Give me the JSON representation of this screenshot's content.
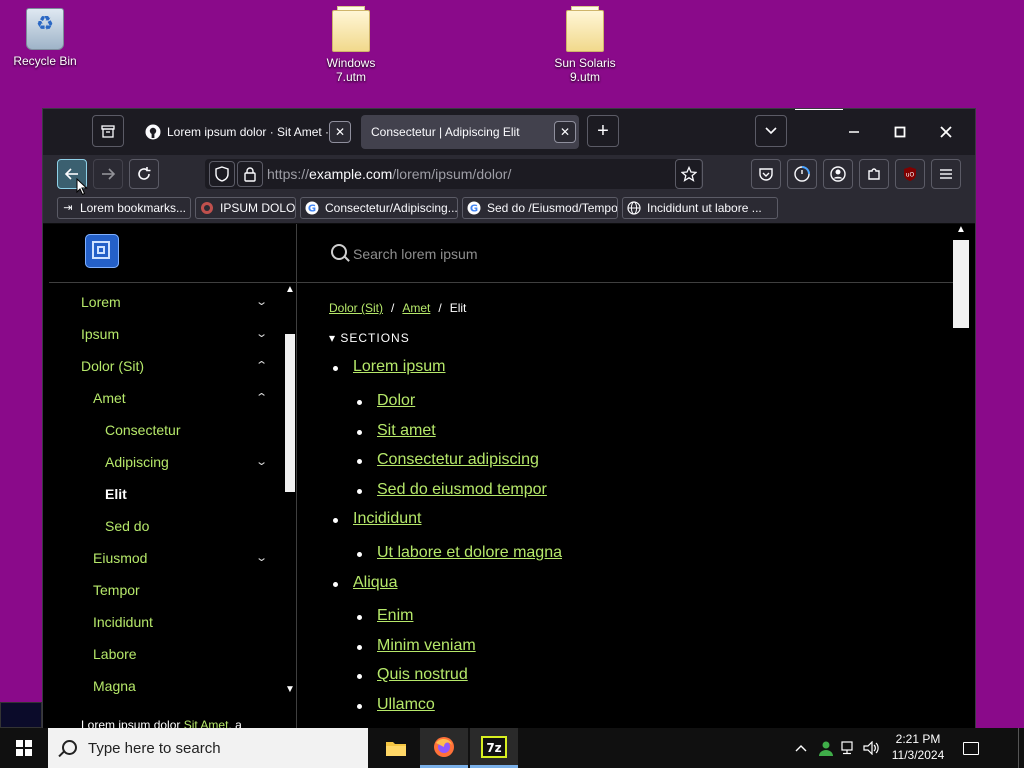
{
  "desktop": {
    "icons": [
      {
        "label": "Recycle Bin"
      },
      {
        "label": "Windows\n7.utm"
      },
      {
        "label": "Sun Solaris\n9.utm"
      }
    ]
  },
  "browser": {
    "tabs": [
      {
        "title": "Lorem ipsum dolor · Sit Amet · …",
        "active": false
      },
      {
        "title": "Consectetur | Adipiscing Elit",
        "active": true
      }
    ],
    "url": {
      "prefix": "https://",
      "host": "example.com",
      "path": "/lorem/ipsum/dolor/"
    },
    "bookmarks": [
      "Lorem bookmarks...",
      "IPSUM DOLOR",
      "Consectetur/Adipiscing...",
      "Sed do /Eiusmod/Tempor",
      "Incididunt ut labore ..."
    ]
  },
  "sidebar": {
    "items": [
      {
        "label": "Lorem",
        "level": 0,
        "chevron": "down"
      },
      {
        "label": "Ipsum",
        "level": 0,
        "chevron": "down"
      },
      {
        "label": "Dolor (Sit)",
        "level": 0,
        "chevron": "up"
      },
      {
        "label": "Amet",
        "level": 1,
        "chevron": "up"
      },
      {
        "label": "Consectetur",
        "level": 2,
        "chevron": ""
      },
      {
        "label": "Adipiscing",
        "level": 2,
        "chevron": "down"
      },
      {
        "label": "Elit",
        "level": 2,
        "chevron": "",
        "current": true
      },
      {
        "label": "Sed do",
        "level": 2,
        "chevron": ""
      },
      {
        "label": "Eiusmod",
        "level": 1,
        "chevron": "down"
      },
      {
        "label": "Tempor",
        "level": 1,
        "chevron": ""
      },
      {
        "label": "Incididunt",
        "level": 1,
        "chevron": ""
      },
      {
        "label": "Labore",
        "level": 1,
        "chevron": ""
      },
      {
        "label": "Magna",
        "level": 1,
        "chevron": ""
      }
    ],
    "footer_prefix": "Lorem ipsum dolor ",
    "footer_link": "Sit Amet",
    "footer_suffix": ", a"
  },
  "main": {
    "search_placeholder": "Search lorem ipsum",
    "breadcrumb": {
      "crumb1": "Dolor (Sit)",
      "crumb2": "Amet",
      "current": "Elit",
      "separator": "/"
    },
    "sections_label": "▾  SECTIONS",
    "toc": [
      {
        "label": "Lorem ipsum",
        "level": 0
      },
      {
        "label": "Dolor",
        "level": 1
      },
      {
        "label": "Sit amet",
        "level": 1
      },
      {
        "label": "Consectetur adipiscing",
        "level": 1
      },
      {
        "label": "Sed do eiusmod tempor",
        "level": 1
      },
      {
        "label": "Incididunt",
        "level": 0
      },
      {
        "label": "Ut labore et dolore magna",
        "level": 1
      },
      {
        "label": "Aliqua",
        "level": 0
      },
      {
        "label": "Enim",
        "level": 1
      },
      {
        "label": "Minim veniam",
        "level": 1
      },
      {
        "label": "Quis nostrud",
        "level": 1
      },
      {
        "label": "Ullamco",
        "level": 1
      }
    ]
  },
  "taskbar": {
    "search_placeholder": "Type here to search",
    "time": "2:21 PM",
    "date": "11/3/2024"
  },
  "colors": {
    "desktop": "#8a0a8a",
    "link": "#b6e86a",
    "browser_chrome": "#2b2a33",
    "active_tab": "#42414d"
  }
}
